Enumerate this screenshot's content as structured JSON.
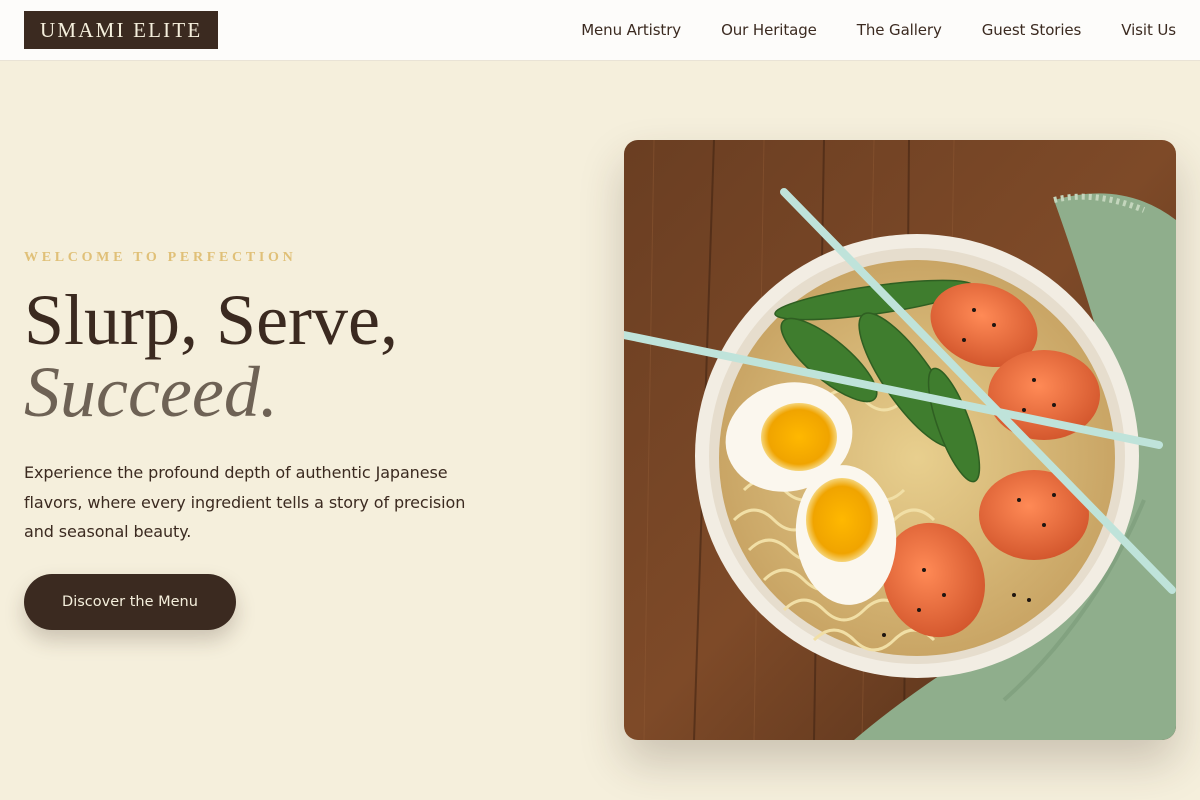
{
  "brand": {
    "name": "UMAMI ELITE"
  },
  "nav": {
    "items": [
      {
        "label": "Menu Artistry"
      },
      {
        "label": "Our Heritage"
      },
      {
        "label": "The Gallery"
      },
      {
        "label": "Guest Stories"
      },
      {
        "label": "Visit Us"
      }
    ]
  },
  "hero": {
    "eyebrow": "WELCOME TO PERFECTION",
    "headline_line1": "Slurp, Serve,",
    "headline_line2": "Succeed.",
    "description": "Experience the profound depth of authentic Japanese flavors, where every ingredient tells a story of precision and seasonal beauty.",
    "cta_label": "Discover the Menu",
    "image_subject": "ramen-bowl-photo"
  },
  "colors": {
    "background": "#f5efdc",
    "primary_dark": "#3b2a20",
    "accent_gold": "#e0c078",
    "muted_text": "#6e6255",
    "header_bg": "#fdfcfa"
  }
}
